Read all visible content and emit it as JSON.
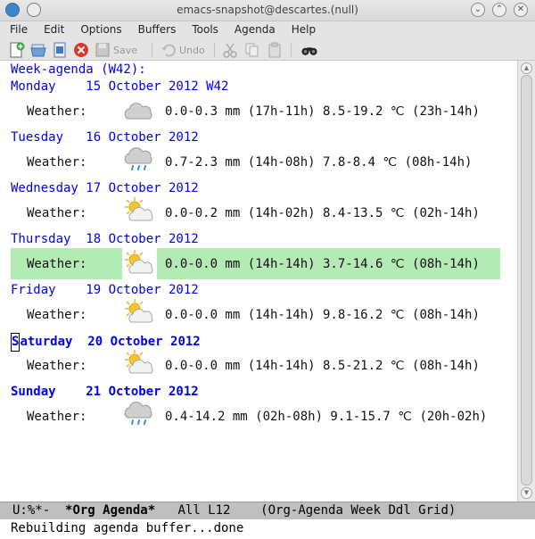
{
  "window": {
    "title": "emacs-snapshot@descartes.(null)"
  },
  "menu": [
    "File",
    "Edit",
    "Options",
    "Buffers",
    "Tools",
    "Agenda",
    "Help"
  ],
  "toolbar": {
    "save_label": "Save",
    "undo_label": "Undo"
  },
  "agenda": {
    "header": "Week-agenda (W42):",
    "days": [
      {
        "label": "Monday    15 October 2012 W42",
        "bold": false,
        "weather": "Weather:",
        "icon": "cloudy-icon",
        "text": "0.0-0.3 mm (17h-11h) 8.5-19.2 ℃ (23h-14h)",
        "highlight": false
      },
      {
        "label": "Tuesday   16 October 2012",
        "bold": false,
        "weather": "Weather:",
        "icon": "rain-icon",
        "text": "0.7-2.3 mm (14h-08h) 7.8-8.4 ℃ (08h-14h)",
        "highlight": false
      },
      {
        "label": "Wednesday 17 October 2012",
        "bold": false,
        "weather": "Weather:",
        "icon": "partly-sunny-icon",
        "text": "0.0-0.2 mm (14h-02h) 8.4-13.5 ℃ (02h-14h)",
        "highlight": false
      },
      {
        "label": "Thursday  18 October 2012",
        "bold": false,
        "weather": "Weather:",
        "icon": "partly-sunny-icon",
        "text": "0.0-0.0 mm (14h-14h) 3.7-14.6 ℃ (08h-14h)",
        "highlight": true
      },
      {
        "label": "Friday    19 October 2012",
        "bold": false,
        "weather": "Weather:",
        "icon": "partly-sunny-icon",
        "text": "0.0-0.0 mm (14h-14h) 9.8-16.2 ℃ (08h-14h)",
        "highlight": false
      },
      {
        "label": "Saturday  20 October 2012",
        "bold": true,
        "weather": "Weather:",
        "icon": "partly-sunny-icon",
        "text": "0.0-0.0 mm (14h-14h) 8.5-21.2 ℃ (08h-14h)",
        "highlight": false
      },
      {
        "label": "Sunday    21 October 2012",
        "bold": true,
        "weather": "Weather:",
        "icon": "rain-icon",
        "text": "0.4-14.2 mm (02h-08h) 9.1-15.7 ℃ (20h-02h)",
        "highlight": false
      }
    ]
  },
  "modeline": {
    "status": "U:%*-  ",
    "buffer": "*Org Agenda*",
    "rest": "   All L12    (Org-Agenda Week Ddl Grid)"
  },
  "echo": "Rebuilding agenda buffer...done",
  "colors": {
    "date_header": "#0000ee",
    "highlight": "#b4eab4",
    "modeline_bg": "#bfbfbf"
  }
}
